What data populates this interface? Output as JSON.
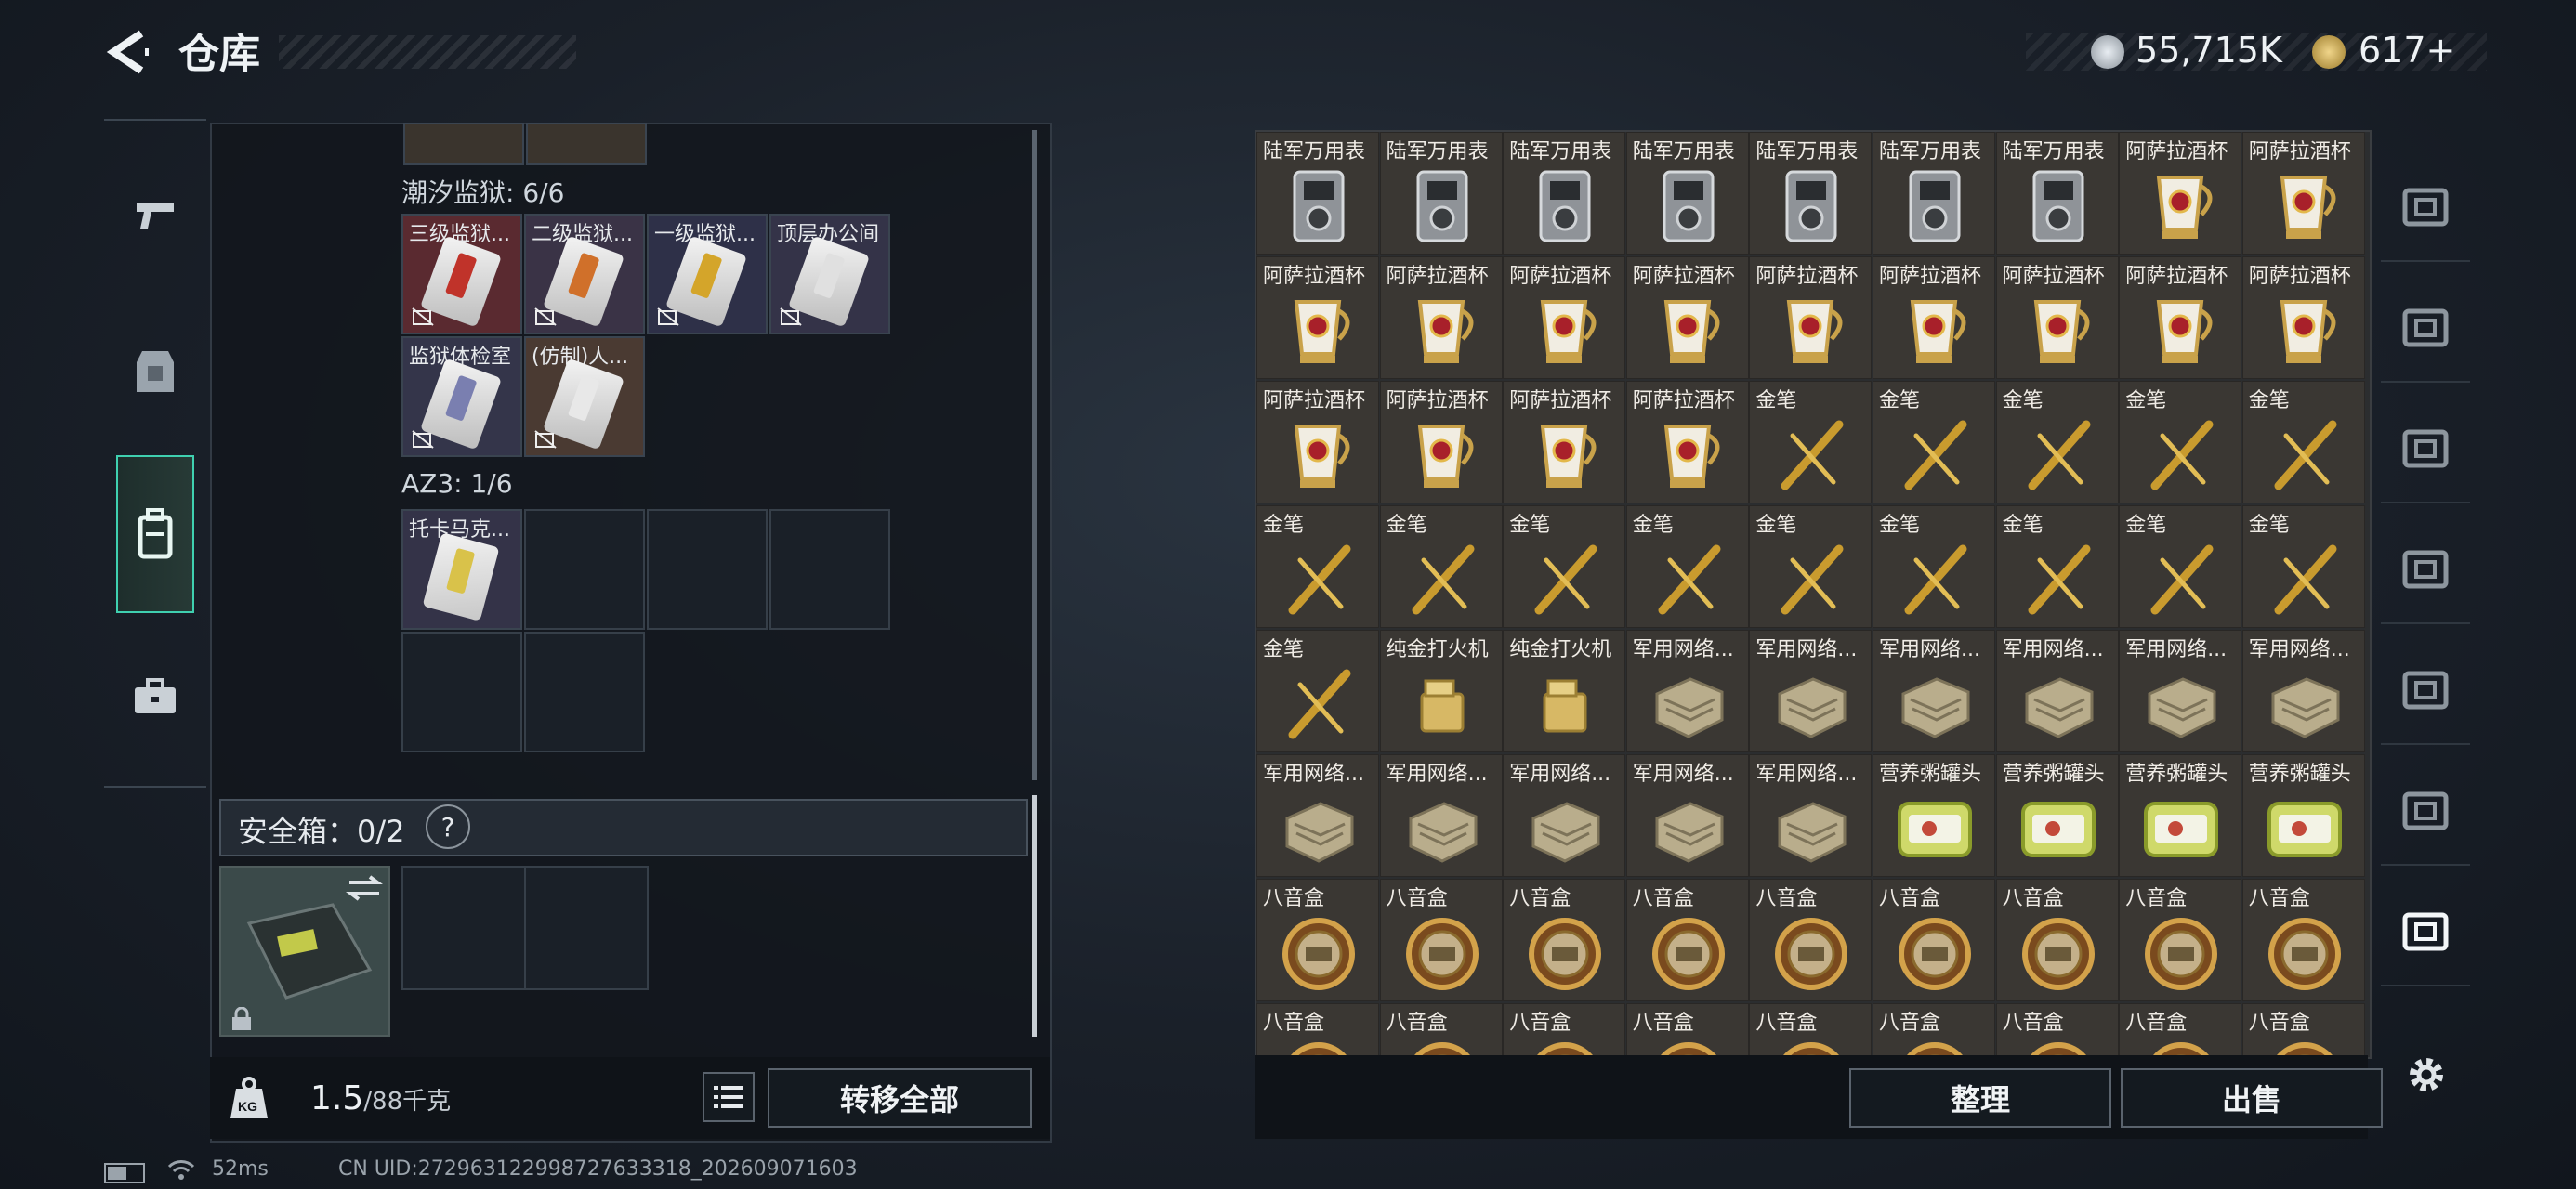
{
  "header": {
    "title": "仓库",
    "silver": "55,715K",
    "gold": "617+"
  },
  "left_nav": [
    {
      "icon": "pistol-icon"
    },
    {
      "icon": "armor-icon"
    },
    {
      "icon": "backpack-icon",
      "active": true
    },
    {
      "icon": "briefcase-icon"
    }
  ],
  "left_panel": {
    "section1": {
      "label": "潮汐监狱: 6/6",
      "items": [
        {
          "label": "三级监狱...",
          "strip": "#c0332a",
          "bg": "#5a2a30"
        },
        {
          "label": "二级监狱...",
          "strip": "#d0702a",
          "bg": "#3a3346"
        },
        {
          "label": "一级监狱...",
          "strip": "#d4a52a",
          "bg": "#2e3048"
        },
        {
          "label": "顶层办公间",
          "strip": "#e0e0e0",
          "bg": "#343348"
        },
        {
          "label": "监狱体检室",
          "strip": "#7a7fb0",
          "bg": "#34354a"
        },
        {
          "label": "(仿制)人...",
          "strip": "#e8e8e8",
          "bg": "#4a3a32"
        }
      ]
    },
    "section2": {
      "label": "AZ3: 1/6",
      "items": [
        {
          "label": "托卡马克..."
        }
      ]
    },
    "safebox": {
      "label": "安全箱：0/2",
      "help": "?"
    },
    "weight": "1.5",
    "weight_unit": "/88千克",
    "kg_icon": "KG",
    "transfer_all": "转移全部"
  },
  "grid_items": [
    [
      "陆军万用表",
      "陆军万用表",
      "陆军万用表",
      "陆军万用表",
      "陆军万用表",
      "陆军万用表",
      "陆军万用表",
      "阿萨拉酒杯",
      "阿萨拉酒杯"
    ],
    [
      "阿萨拉酒杯",
      "阿萨拉酒杯",
      "阿萨拉酒杯",
      "阿萨拉酒杯",
      "阿萨拉酒杯",
      "阿萨拉酒杯",
      "阿萨拉酒杯",
      "阿萨拉酒杯",
      "阿萨拉酒杯"
    ],
    [
      "阿萨拉酒杯",
      "阿萨拉酒杯",
      "阿萨拉酒杯",
      "阿萨拉酒杯",
      "金笔",
      "金笔",
      "金笔",
      "金笔",
      "金笔"
    ],
    [
      "金笔",
      "金笔",
      "金笔",
      "金笔",
      "金笔",
      "金笔",
      "金笔",
      "金笔",
      "金笔"
    ],
    [
      "金笔",
      "纯金打火机",
      "纯金打火机",
      "军用网络...",
      "军用网络...",
      "军用网络...",
      "军用网络...",
      "军用网络...",
      "军用网络..."
    ],
    [
      "军用网络...",
      "军用网络...",
      "军用网络...",
      "军用网络...",
      "军用网络...",
      "营养粥罐头",
      "营养粥罐头",
      "营养粥罐头",
      "营养粥罐头"
    ],
    [
      "八音盒",
      "八音盒",
      "八音盒",
      "八音盒",
      "八音盒",
      "八音盒",
      "八音盒",
      "八音盒",
      "八音盒"
    ],
    [
      "八音盒",
      "八音盒",
      "八音盒",
      "八音盒",
      "八音盒",
      "八音盒",
      "八音盒",
      "八音盒",
      "八音盒"
    ]
  ],
  "right_footer": {
    "sort": "整理",
    "sell": "出售"
  },
  "right_nav": [
    {
      "icon": "helmet-icon"
    },
    {
      "icon": "attachment-2-icon"
    },
    {
      "icon": "attachment-4-plus-icon"
    },
    {
      "icon": "attachment-3-icon"
    },
    {
      "icon": "attachment-5-icon"
    },
    {
      "icon": "attachment-5b-icon"
    },
    {
      "icon": "attachment-5-active-icon",
      "active": true
    }
  ],
  "status": {
    "ping": "52ms",
    "uid": "CN UID:272963122998727633318_202609071603"
  }
}
